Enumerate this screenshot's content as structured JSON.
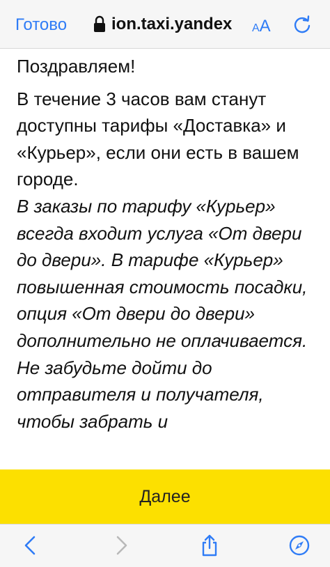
{
  "browser": {
    "done_label": "Готово",
    "url_text": "ion.taxi.yandex",
    "text_size_small": "A",
    "text_size_big": "A",
    "accent_color": "#2f7cf6"
  },
  "content": {
    "congrats": "Поздравляем!",
    "info": "В течение 3 часов вам станут доступны тарифы «Доставка» и «Курьер», если они есть в вашем городе.",
    "italic_note": "В заказы по  тарифу «Курьер» всегда входит услуга «От двери до двери». В тарифе «Курьер» повышенная стоимость посадки, опция «От двери до двери» дополнительно не оплачивается. Не забудьте дойти до отправителя и получателя, чтобы забрать и"
  },
  "cta": {
    "label": "Далее",
    "color": "#fce000"
  },
  "toolbar": {
    "icons": [
      "back-icon",
      "forward-icon",
      "share-icon",
      "compass-icon"
    ]
  }
}
